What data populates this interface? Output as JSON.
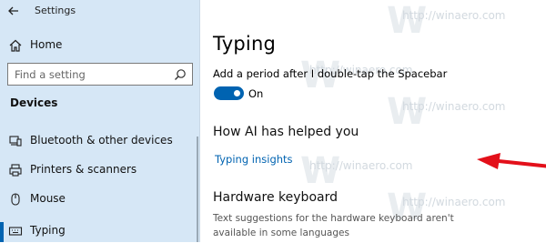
{
  "window": {
    "title": "Settings"
  },
  "sidebar": {
    "home_label": "Home",
    "search_placeholder": "Find a setting",
    "section_title": "Devices",
    "items": [
      {
        "label": "Bluetooth & other devices",
        "icon": "bluetooth-devices-icon"
      },
      {
        "label": "Printers & scanners",
        "icon": "printer-icon"
      },
      {
        "label": "Mouse",
        "icon": "mouse-icon"
      },
      {
        "label": "Typing",
        "icon": "keyboard-icon",
        "selected": true
      }
    ]
  },
  "main": {
    "title": "Typing",
    "period_setting": {
      "label": "Add a period after I double-tap the Spacebar",
      "state": "On",
      "enabled": true
    },
    "how_ai_helped": {
      "heading": "How AI has helped you",
      "link": "Typing insights"
    },
    "hardware_keyboard": {
      "heading": "Hardware keyboard",
      "description": "Text suggestions for the hardware keyboard aren't available in some languages"
    }
  },
  "watermark": {
    "text": "http://winaero.com",
    "letter": "W"
  },
  "colors": {
    "accent": "#0063b1",
    "sidebar_bg": "#d6e7f6",
    "annotation_arrow": "#e3101a"
  }
}
